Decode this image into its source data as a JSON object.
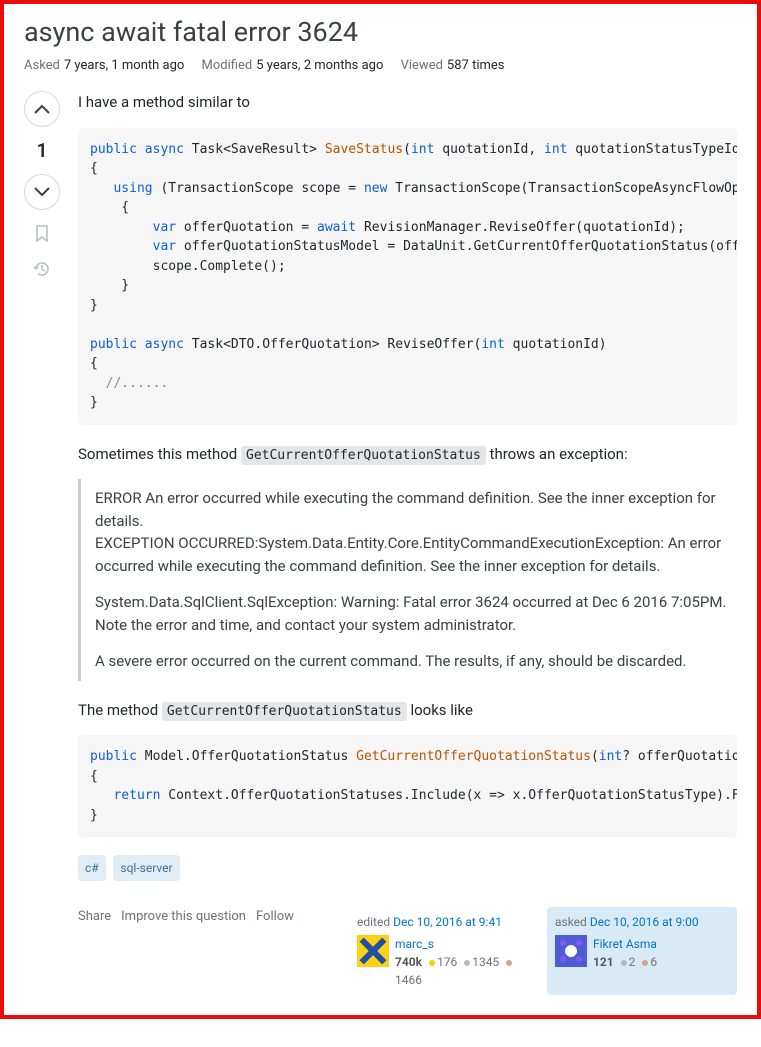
{
  "title": "async await fatal error 3624",
  "stats": {
    "asked_label": "Asked",
    "asked": "7 years, 1 month ago",
    "modified_label": "Modified",
    "modified": "5 years, 2 months ago",
    "viewed_label": "Viewed",
    "viewed": "587 times"
  },
  "vote_count": "1",
  "body": {
    "intro": "I have a method similar to",
    "code1": "public async Task<SaveResult> SaveStatus(int quotationId, int quotationStatusTypeId)\n{\n   using (TransactionScope scope = new TransactionScope(TransactionScopeAsyncFlowOption.Enabled))\n    {\n        var offerQuotation = await RevisionManager.ReviseOffer(quotationId);\n        var offerQuotationStatusModel = DataUnit.GetCurrentOfferQuotationStatus(offerQuotation.Id);\n        scope.Complete();\n    }\n}\n\npublic async Task<DTO.OfferQuotation> ReviseOffer(int quotationId)\n{\n  //......\n}",
    "p2a": "Sometimes this method ",
    "p2code": "GetCurrentOfferQuotationStatus",
    "p2b": " throws an exception:",
    "err1": "ERROR An error occurred while executing the command definition. See the inner exception for details.\nEXCEPTION OCCURRED:System.Data.Entity.Core.EntityCommandExecutionException: An error occurred while executing the command definition. See the inner exception for details.",
    "err2": "System.Data.SqlClient.SqlException: Warning: Fatal error 3624 occurred at Dec 6 2016 7:05PM. Note the error and time, and contact your system administrator.",
    "err3": "A severe error occurred on the current command. The results, if any, should be discarded.",
    "p3a": "The method ",
    "p3code": "GetCurrentOfferQuotationStatus",
    "p3b": " looks like",
    "code2": "public Model.OfferQuotationStatus GetCurrentOfferQuotationStatus(int? offerQuotationId)\n{\n   return Context.OfferQuotationStatuses.Include(x => x.OfferQuotationStatusType).FirstOrDefault();\n}"
  },
  "tags": [
    "c#",
    "sql-server"
  ],
  "actions": {
    "share": "Share",
    "improve": "Improve this question",
    "follow": "Follow"
  },
  "editor": {
    "action": "edited",
    "time": "Dec 10, 2016 at 9:41",
    "name": "marc_s",
    "rep": "740k",
    "gold": "176",
    "silver": "1345",
    "bronze": "1466"
  },
  "asker": {
    "action": "asked",
    "time": "Dec 10, 2016 at 9:00",
    "name": "Fikret Asma",
    "rep": "121",
    "silver": "2",
    "bronze": "6"
  }
}
